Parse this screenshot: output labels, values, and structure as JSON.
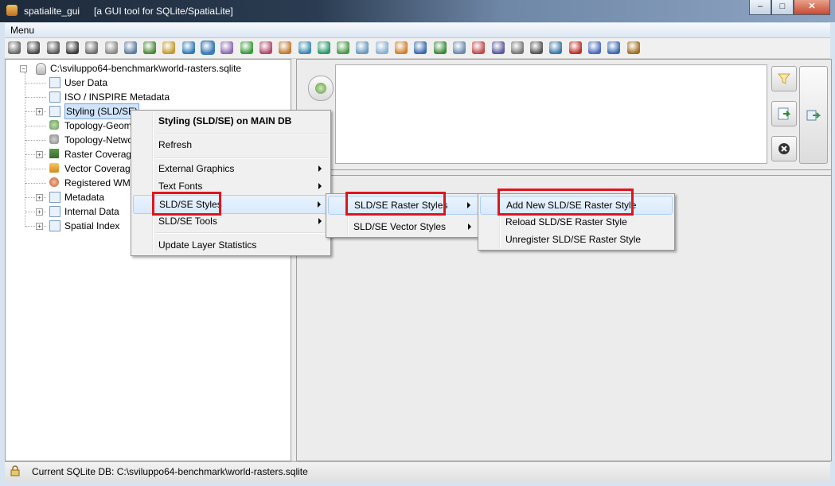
{
  "window": {
    "app_name": "spatialite_gui",
    "subtitle": "[a GUI tool for SQLite/SpatiaLite]",
    "min_glyph": "‒",
    "max_glyph": "□",
    "close_glyph": "✕"
  },
  "menubar": {
    "menu_label": "Menu"
  },
  "toolbar": {
    "icons": [
      "connect-icon",
      "disconnect-icon",
      "create-db-icon",
      "memory-db-icon",
      "save-memory-icon",
      "clone-db-icon",
      "vacuum-icon",
      "sql-script-icon",
      "load-shp-icon",
      "attach-icon",
      "mode-icon",
      "map-icon",
      "chart-icon",
      "debug-icon",
      "network-icon",
      "load-dbf-icon",
      "virtual-csv-icon",
      "virtual-xl-icon",
      "load-xl-icon",
      "load-txt-icon",
      "dxf-icon",
      "srid-icon",
      "exif-icon",
      "gps-icon",
      "load-raster-icon",
      "check-icon",
      "list-icon",
      "sort-icon",
      "wms-icon",
      "font-icon",
      "help-icon",
      "about-icon",
      "exit-icon"
    ],
    "active_index": 10
  },
  "tree": {
    "root": "C:\\sviluppo64-benchmark\\world-rasters.sqlite",
    "items": [
      {
        "label": "User Data",
        "expander": false
      },
      {
        "label": "ISO / INSPIRE Metadata",
        "expander": false
      },
      {
        "label": "Styling (SLD/SE)",
        "expander": true,
        "selected": true
      },
      {
        "label": "Topology-Geom",
        "expander": false
      },
      {
        "label": "Topology-Netwo",
        "expander": false
      },
      {
        "label": "Raster Coverage",
        "expander": true
      },
      {
        "label": "Vector Coverage",
        "expander": false
      },
      {
        "label": "Registered WMS",
        "expander": false
      },
      {
        "label": "Metadata",
        "expander": true
      },
      {
        "label": "Internal Data",
        "expander": true
      },
      {
        "label": "Spatial Index",
        "expander": true
      }
    ]
  },
  "context_menu": {
    "header": "Styling (SLD/SE) on MAIN DB",
    "refresh": "Refresh",
    "external_graphics": "External Graphics",
    "text_fonts": "Text Fonts",
    "sld_se_styles": "SLD/SE Styles",
    "sld_se_tools": "SLD/SE Tools",
    "update_layer_statistics": "Update Layer Statistics"
  },
  "submenu_styles": {
    "raster_styles": "SLD/SE Raster Styles",
    "vector_styles": "SLD/SE Vector Styles"
  },
  "submenu_raster": {
    "add_new": "Add New SLD/SE Raster Style",
    "reload": "Reload SLD/SE Raster Style",
    "unregister": "Unregister SLD/SE Raster Style"
  },
  "statusbar": {
    "text": "Current SQLite DB: C:\\sviluppo64-benchmark\\world-rasters.sqlite"
  },
  "colors": {
    "highlight_box": "#e0141e",
    "selection": "#cfe4fa"
  }
}
